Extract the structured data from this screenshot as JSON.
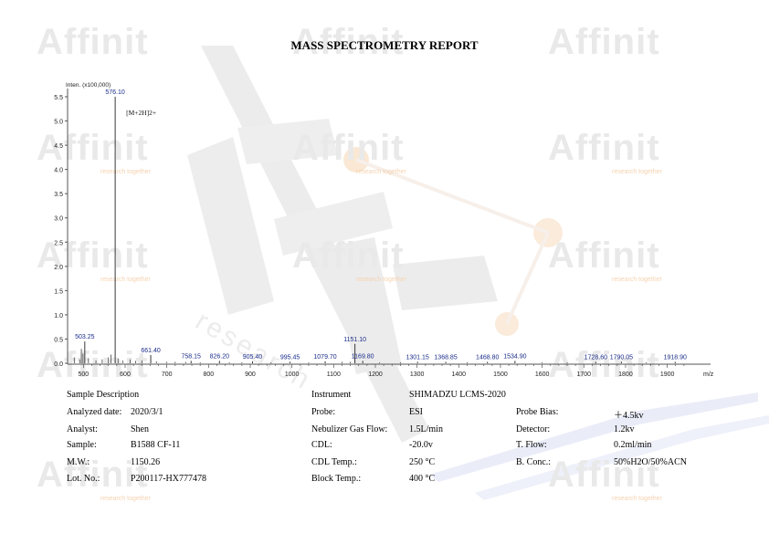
{
  "report": {
    "title": "MASS SPECTROMETRY REPORT"
  },
  "watermark": {
    "logo_text": "Affinit",
    "tagline": "research together",
    "diagonal_text": "research"
  },
  "colors": {
    "peak_label": "#1a2c8a",
    "axis": "#555555",
    "watermark_gray": "#e3e3e3",
    "watermark_orange": "#f7d9b8",
    "watermark_blue": "#e2e6f6"
  },
  "chart_data": {
    "type": "bar",
    "subtype": "mass spectrum",
    "ylabel": "Inten. (x100,000)",
    "xlabel": "m/z",
    "xlim": [
      462,
      1960
    ],
    "ylim": [
      0,
      5.5
    ],
    "x_ticks": [
      "500",
      "600",
      "700",
      "800",
      "900",
      "1000",
      "1100",
      "1200",
      "1300",
      "1400",
      "1500",
      "1600",
      "1700",
      "1800",
      "1900"
    ],
    "y_ticks": [
      "0.0",
      "0.5",
      "1.0",
      "1.5",
      "2.0",
      "2.5",
      "3.0",
      "3.5",
      "4.0",
      "4.5",
      "5.0",
      "5.5"
    ],
    "annotation": "[M+2H]2+",
    "labeled_peaks": [
      {
        "mz": 503.25,
        "intensity": 0.45,
        "label": "503.25"
      },
      {
        "mz": 576.1,
        "intensity": 5.5,
        "label": "576.10"
      },
      {
        "mz": 661.4,
        "intensity": 0.17,
        "label": "661.40"
      },
      {
        "mz": 758.15,
        "intensity": 0.05,
        "label": "758.15"
      },
      {
        "mz": 826.2,
        "intensity": 0.05,
        "label": "826.20"
      },
      {
        "mz": 905.4,
        "intensity": 0.04,
        "label": "905.40"
      },
      {
        "mz": 995.45,
        "intensity": 0.03,
        "label": "995.45"
      },
      {
        "mz": 1079.7,
        "intensity": 0.04,
        "label": "1079.70"
      },
      {
        "mz": 1151.1,
        "intensity": 0.4,
        "label": "1151.10"
      },
      {
        "mz": 1169.8,
        "intensity": 0.05,
        "label": "1169.80"
      },
      {
        "mz": 1301.15,
        "intensity": 0.03,
        "label": "1301.15"
      },
      {
        "mz": 1368.85,
        "intensity": 0.03,
        "label": "1368.85"
      },
      {
        "mz": 1468.8,
        "intensity": 0.03,
        "label": "1468.80"
      },
      {
        "mz": 1534.9,
        "intensity": 0.05,
        "label": "1534.90"
      },
      {
        "mz": 1728.6,
        "intensity": 0.03,
        "label": "1728.60"
      },
      {
        "mz": 1790.05,
        "intensity": 0.03,
        "label": "1790.05"
      },
      {
        "mz": 1918.9,
        "intensity": 0.03,
        "label": "1918.90"
      }
    ],
    "minor_peaks": [
      {
        "mz": 478,
        "intensity": 0.12
      },
      {
        "mz": 491,
        "intensity": 0.08
      },
      {
        "mz": 495,
        "intensity": 0.3
      },
      {
        "mz": 499,
        "intensity": 0.2
      },
      {
        "mz": 512,
        "intensity": 0.1
      },
      {
        "mz": 530,
        "intensity": 0.06
      },
      {
        "mz": 545,
        "intensity": 0.08
      },
      {
        "mz": 560,
        "intensity": 0.12
      },
      {
        "mz": 566,
        "intensity": 0.18
      },
      {
        "mz": 583,
        "intensity": 0.1
      },
      {
        "mz": 594,
        "intensity": 0.06
      },
      {
        "mz": 612,
        "intensity": 0.08
      },
      {
        "mz": 625,
        "intensity": 0.05
      },
      {
        "mz": 640,
        "intensity": 0.06
      },
      {
        "mz": 675,
        "intensity": 0.04
      },
      {
        "mz": 700,
        "intensity": 0.03
      },
      {
        "mz": 720,
        "intensity": 0.03
      },
      {
        "mz": 745,
        "intensity": 0.03
      },
      {
        "mz": 780,
        "intensity": 0.02
      },
      {
        "mz": 850,
        "intensity": 0.02
      },
      {
        "mz": 880,
        "intensity": 0.02
      },
      {
        "mz": 950,
        "intensity": 0.02
      },
      {
        "mz": 1040,
        "intensity": 0.02
      },
      {
        "mz": 1120,
        "intensity": 0.03
      },
      {
        "mz": 1140,
        "intensity": 0.03
      },
      {
        "mz": 1210,
        "intensity": 0.02
      },
      {
        "mz": 1260,
        "intensity": 0.02
      },
      {
        "mz": 1420,
        "intensity": 0.02
      },
      {
        "mz": 1600,
        "intensity": 0.02
      },
      {
        "mz": 1660,
        "intensity": 0.02
      },
      {
        "mz": 1850,
        "intensity": 0.02
      }
    ]
  },
  "sample": {
    "heading": "Sample Description",
    "rows": [
      {
        "label": "Analyzed date:",
        "value": "2020/3/1"
      },
      {
        "label": "Analyst:",
        "value": "Shen"
      },
      {
        "label": "Sample:",
        "value": "B1588 CF-11"
      },
      {
        "label": "M.W.:",
        "value": "1150.26"
      },
      {
        "label": "Lot. No.:",
        "value": "P200117-HX777478"
      }
    ]
  },
  "instrument": {
    "heading": "Instrument",
    "name": "SHIMADZU LCMS-2020",
    "rows": [
      {
        "label": "Probe:",
        "value": "ESI"
      },
      {
        "label": "Nebulizer Gas Flow:",
        "value": "1.5L/min"
      },
      {
        "label": "CDL:",
        "value": "-20.0v"
      },
      {
        "label": "CDL Temp.:",
        "value": "250 °C"
      },
      {
        "label": "Block Temp.:",
        "value": "400 °C"
      }
    ]
  },
  "conditions": {
    "rows": [
      {
        "label": "Probe Bias:",
        "value": "＋4.5kv"
      },
      {
        "label": "Detector:",
        "value": "1.2kv"
      },
      {
        "label": "T. Flow:",
        "value": "0.2ml/min"
      },
      {
        "label": "B. Conc.:",
        "value": "50%H2O/50%ACN"
      }
    ]
  }
}
